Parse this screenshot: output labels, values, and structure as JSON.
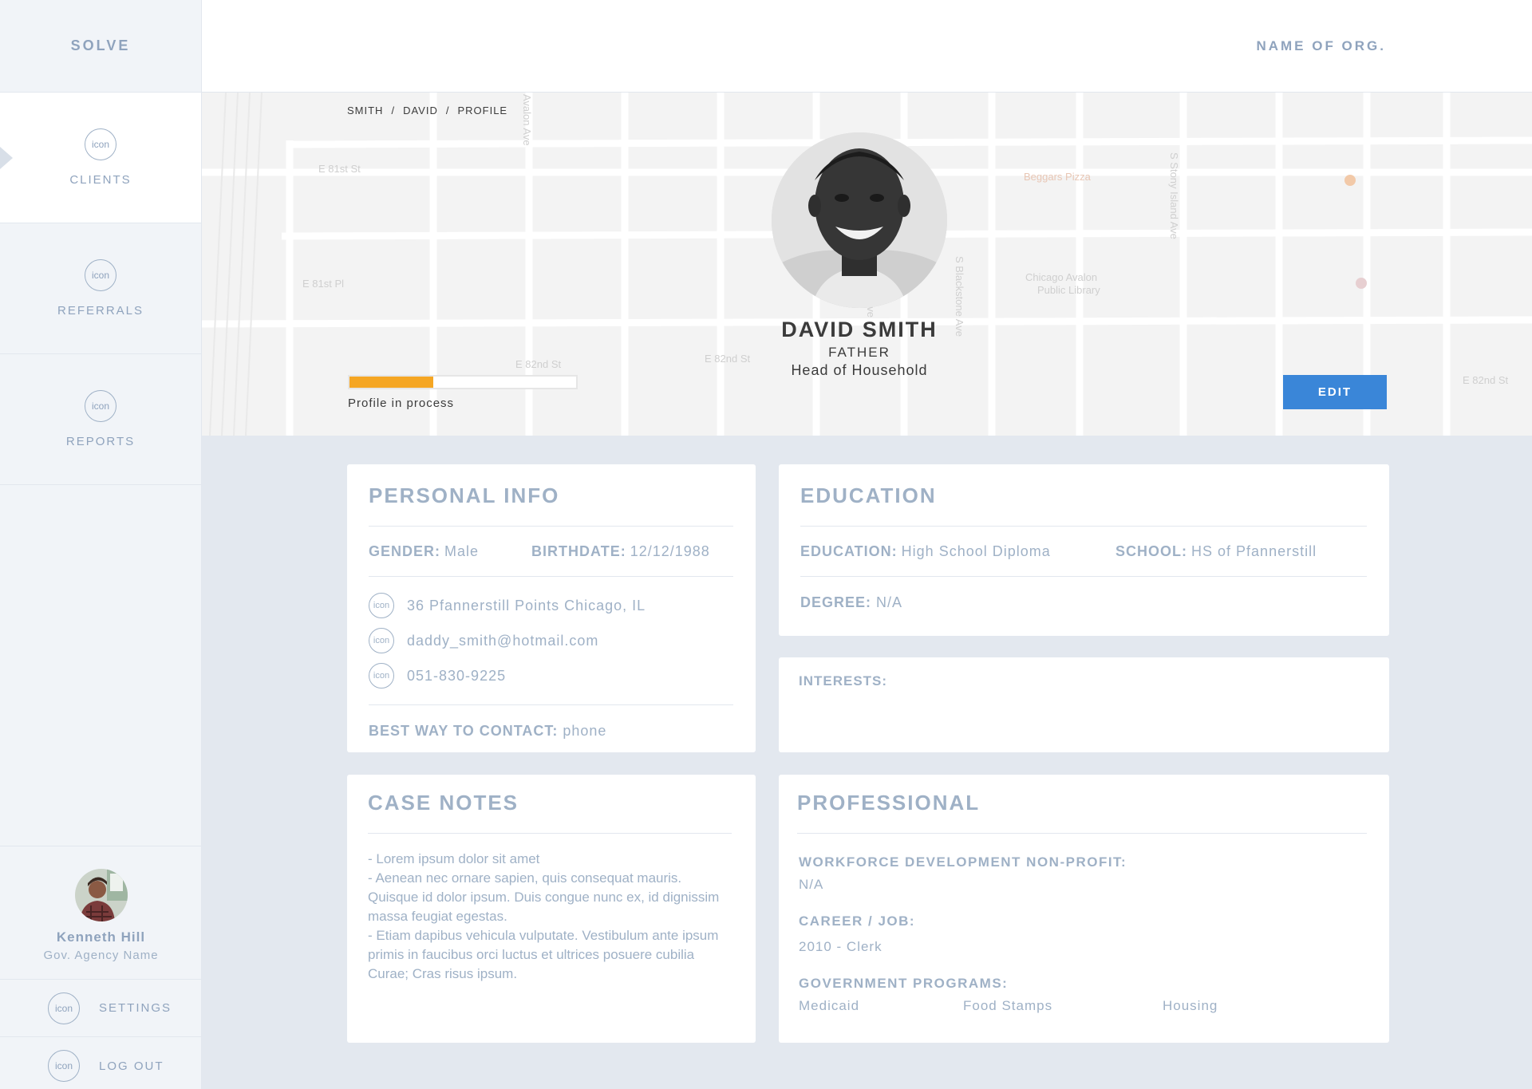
{
  "app": {
    "logo": "SOLVE",
    "org_name": "NAME OF ORG."
  },
  "sidebar": {
    "items": [
      {
        "label": "CLIENTS",
        "icon": "icon",
        "active": true
      },
      {
        "label": "REFERRALS",
        "icon": "icon",
        "active": false
      },
      {
        "label": "REPORTS",
        "icon": "icon",
        "active": false
      }
    ],
    "user": {
      "name": "Kenneth Hill",
      "org": "Gov. Agency Name"
    },
    "settings": {
      "label": "SETTINGS",
      "icon": "icon"
    },
    "logout": {
      "label": "LOG OUT",
      "icon": "icon"
    }
  },
  "breadcrumb": [
    "SMITH",
    "DAVID",
    "PROFILE"
  ],
  "breadcrumb_sep": "/",
  "map_labels": [
    "E 81st St",
    "E 81st Pl",
    "E 82nd St",
    "E 82nd St",
    "Avalon Ave",
    "Beggars Pizza",
    "Chicago Avalon",
    "Public Library",
    "S Dante Ave",
    "S Blackstone Ave",
    "S Stony Island Ave",
    "E 82nd St"
  ],
  "profile": {
    "name": "DAVID SMITH",
    "role": "FATHER",
    "household": "Head of Household",
    "progress_fraction": 0.37,
    "progress_label": "Profile in process",
    "edit_label": "EDIT"
  },
  "personal_info": {
    "title": "PERSONAL INFO",
    "gender_key": "GENDER:",
    "gender": "Male",
    "birthdate_key": "BIRTHDATE:",
    "birthdate": "12/12/1988",
    "address": "36 Pfannerstill Points Chicago, IL",
    "email": "daddy_smith@hotmail.com",
    "phone": "051-830-9225",
    "contact_icon": "icon",
    "best_contact_key": "BEST WAY TO CONTACT:",
    "best_contact": "phone"
  },
  "education": {
    "title": "EDUCATION",
    "education_key": "EDUCATION:",
    "education": "High School Diploma",
    "school_key": "SCHOOL:",
    "school": "HS of Pfannerstill",
    "degree_key": "DEGREE:",
    "degree": "N/A"
  },
  "interests": {
    "title": "INTERESTS:"
  },
  "case_notes": {
    "title": "CASE NOTES",
    "text": "- Lorem ipsum dolor sit amet\n- Aenean nec ornare sapien, quis consequat mauris. Quisque id dolor ipsum. Duis congue nunc ex, id dignissim massa feugiat egestas.\n- Etiam dapibus vehicula vulputate. Vestibulum ante ipsum primis in faucibus orci luctus et ultrices posuere cubilia Curae; Cras risus ipsum."
  },
  "professional": {
    "title": "PROFESSIONAL",
    "workforce_key": "WORKFORCE DEVELOPMENT NON-PROFIT:",
    "workforce": "N/A",
    "career_key": "CAREER / JOB:",
    "career": "2010 - Clerk",
    "programs_key": "GOVERNMENT PROGRAMS:",
    "programs": [
      "Medicaid",
      "Food Stamps",
      "Housing"
    ]
  },
  "colors": {
    "accent": "#3a86d8",
    "progress": "#f5a623",
    "muted_text": "#8fa3bd",
    "background": "#e3e8ef"
  }
}
